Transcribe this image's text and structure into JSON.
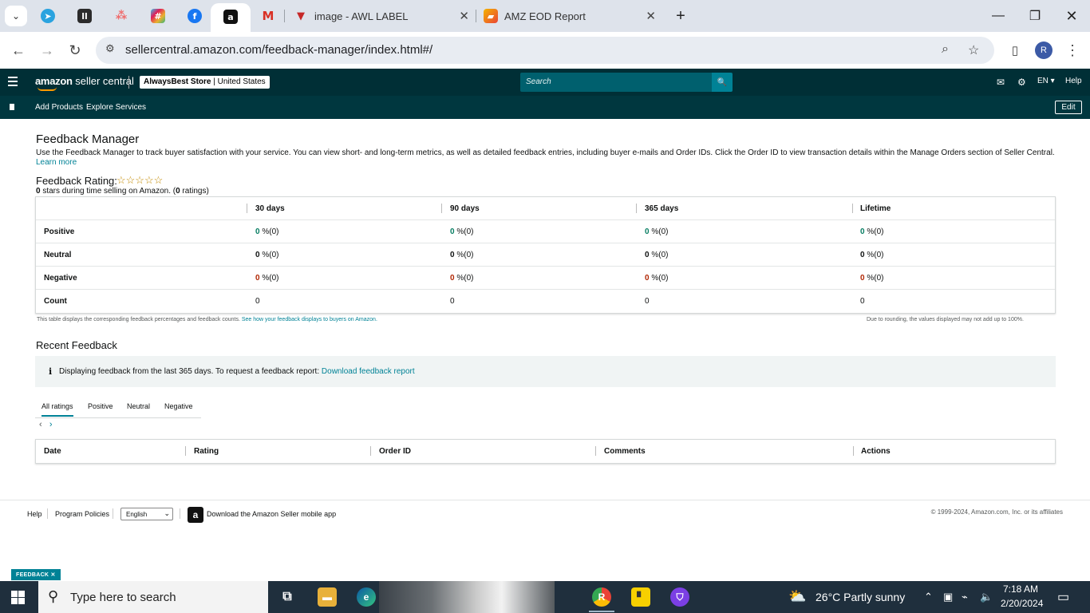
{
  "browser": {
    "tabs": [
      {
        "label": "image - AWL LABEL"
      },
      {
        "label": "AMZ EOD Report"
      }
    ],
    "url": "sellercentral.amazon.com/feedback-manager/index.html#/",
    "profile_initial": "R"
  },
  "header": {
    "logo_text": "amazon",
    "logo_suffix": " seller central",
    "store_name": "AlwaysBest Store",
    "store_region": " | United States",
    "search_placeholder": "Search",
    "language": "EN",
    "help": "Help"
  },
  "nav": {
    "links": [
      "Add Products",
      "Explore Services"
    ],
    "edit": "Edit"
  },
  "main": {
    "title": "Feedback Manager",
    "description": "Use the Feedback Manager to track buyer satisfaction with your service. You can view short- and long-term metrics, as well as detailed feedback entries, including buyer e-mails and Order IDs. Click the Order ID to view transaction details within the Manage Orders section of Seller Central.",
    "learn_more": "Learn more",
    "rating_label": "Feedback Rating:",
    "rating_stars": "☆☆☆☆☆",
    "rating_count_stars": "0",
    "rating_sub_mid": " stars during time selling on Amazon. (",
    "rating_count": "0",
    "rating_sub_end": " ratings)",
    "table": {
      "columns": [
        "30 days",
        "90 days",
        "365 days",
        "Lifetime"
      ],
      "rows": [
        {
          "label": "Positive",
          "values": [
            "0",
            "0",
            "0",
            "0"
          ],
          "suffix": " %(0)"
        },
        {
          "label": "Neutral",
          "values": [
            "0",
            "0",
            "0",
            "0"
          ],
          "suffix": " %(0)"
        },
        {
          "label": "Negative",
          "values": [
            "0",
            "0",
            "0",
            "0"
          ],
          "suffix": " %(0)"
        },
        {
          "label": "Count",
          "values": [
            "0",
            "0",
            "0",
            "0"
          ],
          "suffix": ""
        }
      ]
    },
    "table_note": "This table displays the corresponding feedback percentages and feedback counts. ",
    "table_note_link": "See how your feedback displays to buyers on Amazon.",
    "rounding_note": "Due to rounding, the values displayed may not add up to 100%.",
    "recent_title": "Recent Feedback",
    "info_text": "Displaying feedback from the last 365 days. To request a feedback report: ",
    "info_link": "Download feedback report",
    "rating_tabs": [
      "All ratings",
      "Positive",
      "Neutral",
      "Negative"
    ],
    "recent_columns": [
      "Date",
      "Rating",
      "Order ID",
      "Comments",
      "Actions"
    ]
  },
  "footer": {
    "links": [
      "Help",
      "Program Policies"
    ],
    "language": "English",
    "app_text": "Download the Amazon Seller mobile app",
    "copyright": "© 1999-2024, Amazon.com, Inc. or its affiliates",
    "feedback_tag": "FEEDBACK ✕"
  },
  "taskbar": {
    "search_placeholder": "Type here to search",
    "weather": "26°C  Partly sunny",
    "time": "7:18 AM",
    "date": "2/20/2024"
  }
}
